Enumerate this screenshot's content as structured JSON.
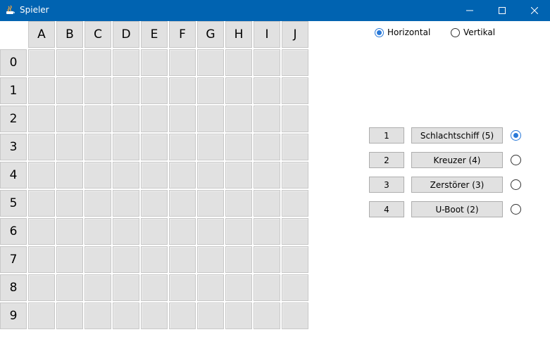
{
  "window": {
    "title": "Spieler"
  },
  "grid": {
    "columns": [
      "A",
      "B",
      "C",
      "D",
      "E",
      "F",
      "G",
      "H",
      "I",
      "J"
    ],
    "rows": [
      "0",
      "1",
      "2",
      "3",
      "4",
      "5",
      "6",
      "7",
      "8",
      "9"
    ]
  },
  "orientation": {
    "options": [
      {
        "label": "Horizontal",
        "checked": true
      },
      {
        "label": "Vertikal",
        "checked": false
      }
    ]
  },
  "ships": [
    {
      "count": "1",
      "name": "Schlachtschiff (5)",
      "selected": true
    },
    {
      "count": "2",
      "name": "Kreuzer (4)",
      "selected": false
    },
    {
      "count": "3",
      "name": "Zerstörer (3)",
      "selected": false
    },
    {
      "count": "4",
      "name": "U-Boot (2)",
      "selected": false
    }
  ],
  "colors": {
    "titlebar": "#0063b1",
    "accent": "#2979d8",
    "cell": "#e1e1e1"
  }
}
